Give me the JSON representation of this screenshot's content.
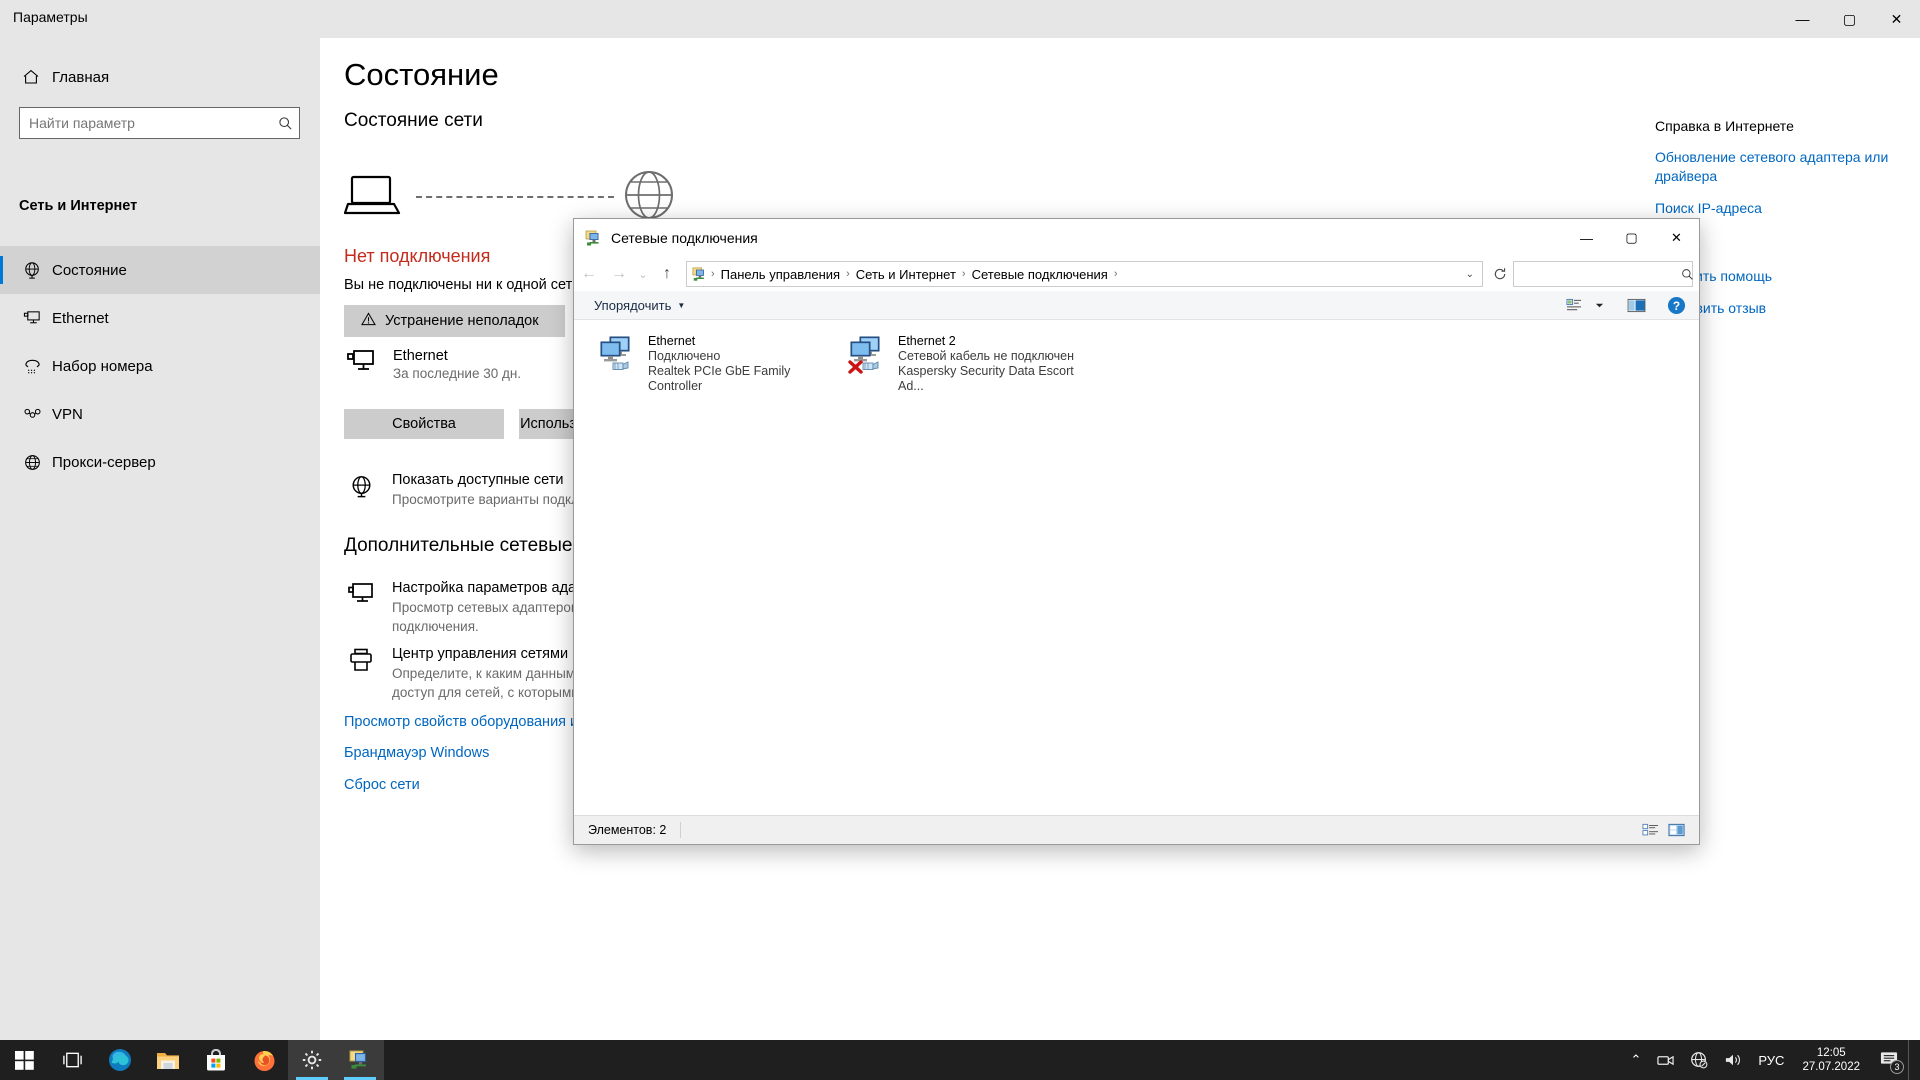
{
  "settings": {
    "window_title": "Параметры",
    "window_buttons": {
      "minimize": "—",
      "maximize": "▢",
      "close": "✕"
    },
    "sidebar": {
      "home_label": "Главная",
      "home_icon": "home-icon",
      "search_placeholder": "Найти параметр",
      "search_value": "",
      "section_label": "Сеть и Интернет",
      "items": [
        {
          "label": "Состояние",
          "icon": "globe-status-icon",
          "active": true
        },
        {
          "label": "Ethernet",
          "icon": "ethernet-icon",
          "active": false
        },
        {
          "label": "Набор номера",
          "icon": "dialup-icon",
          "active": false
        },
        {
          "label": "VPN",
          "icon": "vpn-icon",
          "active": false
        },
        {
          "label": "Прокси-сервер",
          "icon": "proxy-globe-icon",
          "active": false
        }
      ]
    },
    "main": {
      "page_title": "Состояние",
      "section_title": "Состояние сети",
      "status_headline": "Нет подключения",
      "status_headline_color": "#c42b1c",
      "status_sub": "Вы не подключены ни к одной сети.",
      "troubleshoot_button": "Устранение неполадок",
      "adapter": {
        "name": "Ethernet",
        "sub": "За последние 30 дн."
      },
      "properties_button": "Свойства",
      "usage_button": "Использование данных",
      "show_networks": {
        "title": "Показать доступные сети",
        "desc": "Просмотрите варианты подключения."
      },
      "advanced_title": "Дополнительные сетевые параметры",
      "adapter_options": {
        "title": "Настройка параметров адаптера",
        "desc": "Просмотр сетевых адаптеров и изменение параметров подключения."
      },
      "sharing_center": {
        "title": "Центр управления сетями и общим доступом",
        "desc": "Определите, к каким данным вы хотите предоставить доступ для сетей, с которыми установлено соединение."
      },
      "links": [
        "Просмотр свойств оборудования и подключения",
        "Брандмауэр Windows",
        "Сброс сети"
      ]
    },
    "help_panel": {
      "title": "Справка в Интернете",
      "links": [
        "Обновление сетевого адаптера или драйвера",
        "Поиск IP-адреса"
      ],
      "secondary_links": [
        "Получить помощь",
        "Отправить отзыв"
      ]
    }
  },
  "explorer": {
    "title": "Сетевые подключения",
    "title_icon": "network-connections-icon",
    "window_buttons": {
      "minimize": "—",
      "maximize": "▢",
      "close": "✕"
    },
    "nav": {
      "back": "←",
      "forward": "→",
      "recent": "⌄",
      "up": "↑"
    },
    "breadcrumbs": [
      "Панель управления",
      "Сеть и Интернет",
      "Сетевые подключения"
    ],
    "address_dropdown": "⌄",
    "refresh_icon": "refresh-icon",
    "search_placeholder": "",
    "search_value": "",
    "toolbar": {
      "organize_label": "Упорядочить",
      "organize_caret": "▼",
      "view_icon": "view-options-icon",
      "view_caret": "▼",
      "preview_icon": "preview-pane-icon",
      "help_icon": "help-icon"
    },
    "connections": [
      {
        "name": "Ethernet",
        "status": "Подключено",
        "device": "Realtek PCIe GbE Family Controller",
        "disconnected": false
      },
      {
        "name": "Ethernet 2",
        "status": "Сетевой кабель не подключен",
        "device": "Kaspersky Security Data Escort Ad...",
        "disconnected": true
      }
    ],
    "status_bar": {
      "count_label": "Элементов: 2",
      "view_details_icon": "details-view-icon",
      "view_tiles_icon": "tiles-view-icon"
    }
  },
  "taskbar": {
    "items": [
      {
        "name": "start-button",
        "icon": "windows-logo-icon",
        "active": false
      },
      {
        "name": "task-view-button",
        "icon": "task-view-icon",
        "active": false
      },
      {
        "name": "edge-button",
        "icon": "edge-icon",
        "active": false
      },
      {
        "name": "file-explorer-button",
        "icon": "folder-icon",
        "active": false
      },
      {
        "name": "microsoft-store-button",
        "icon": "store-icon",
        "active": false
      },
      {
        "name": "firefox-button",
        "icon": "firefox-icon",
        "active": false
      },
      {
        "name": "settings-button",
        "icon": "gear-icon",
        "active": true
      },
      {
        "name": "network-connections-button",
        "icon": "network-connections-icon",
        "active": true
      }
    ],
    "tray": {
      "chevron": "⌃",
      "camera_icon": "camera-privacy-icon",
      "network_icon": "network-disconnected-icon",
      "volume_icon": "volume-icon",
      "language": "РУС",
      "time": "12:05",
      "date": "27.07.2022",
      "notification_icon": "notifications-icon",
      "notification_count": "3"
    }
  },
  "colors": {
    "accent": "#0078d7",
    "link": "#0067c0",
    "error": "#c42b1c",
    "settings_bg": "#ffffff",
    "sidebar_bg": "#e6e6e6",
    "taskbar_bg": "#1f1f1f"
  }
}
